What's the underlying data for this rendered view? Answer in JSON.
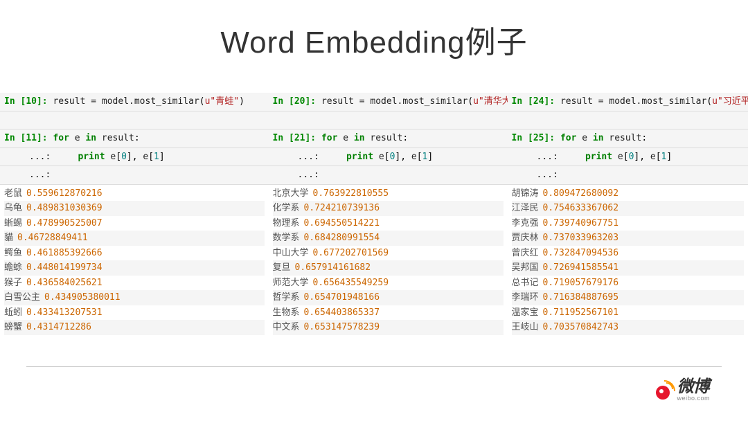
{
  "title": "Word Embedding例子",
  "panels": [
    {
      "in1_num": "10",
      "in2_num": "11",
      "query": "u\"青蛙\"",
      "results": [
        {
          "word": "老鼠",
          "score": "0.559612870216"
        },
        {
          "word": "乌龟",
          "score": "0.489831030369"
        },
        {
          "word": "蜥蜴",
          "score": "0.478990525007"
        },
        {
          "word": "貓",
          "score": "0.46728849411"
        },
        {
          "word": "鳄鱼",
          "score": "0.461885392666"
        },
        {
          "word": "蟾蜍",
          "score": "0.448014199734"
        },
        {
          "word": "猴子",
          "score": "0.436584025621"
        },
        {
          "word": "白雪公主",
          "score": "0.434905380011"
        },
        {
          "word": "蚯蚓",
          "score": "0.433413207531"
        },
        {
          "word": "螃蟹",
          "score": "0.4314712286"
        }
      ]
    },
    {
      "in1_num": "20",
      "in2_num": "21",
      "query": "u\"清华大学",
      "results": [
        {
          "word": "北京大学",
          "score": "0.763922810555"
        },
        {
          "word": "化学系",
          "score": "0.724210739136"
        },
        {
          "word": "物理系",
          "score": "0.694550514221"
        },
        {
          "word": "数学系",
          "score": "0.684280991554"
        },
        {
          "word": "中山大学",
          "score": "0.677202701569"
        },
        {
          "word": "复旦",
          "score": "0.657914161682"
        },
        {
          "word": "师范大学",
          "score": "0.656435549259"
        },
        {
          "word": "哲学系",
          "score": "0.654701948166"
        },
        {
          "word": "生物系",
          "score": "0.654403865337"
        },
        {
          "word": "中文系",
          "score": "0.653147578239"
        }
      ]
    },
    {
      "in1_num": "24",
      "in2_num": "25",
      "query": "u\"习近平\"",
      "results": [
        {
          "word": "胡锦涛",
          "score": "0.809472680092"
        },
        {
          "word": "江泽民",
          "score": "0.754633367062"
        },
        {
          "word": "李克强",
          "score": "0.739740967751"
        },
        {
          "word": "贾庆林",
          "score": "0.737033963203"
        },
        {
          "word": "曾庆红",
          "score": "0.732847094536"
        },
        {
          "word": "吴邦国",
          "score": "0.726941585541"
        },
        {
          "word": "总书记",
          "score": "0.719057679176"
        },
        {
          "word": "李瑞环",
          "score": "0.716384887695"
        },
        {
          "word": "温家宝",
          "score": "0.711952567101"
        },
        {
          "word": "王岐山",
          "score": "0.703570842743"
        }
      ]
    }
  ],
  "code": {
    "assign": "result = model.",
    "method": "most_similar",
    "for_kw": "for",
    "in_kw": "in",
    "var_e": "e",
    "var_result": "result",
    "print_kw": "print",
    "idx0": "0",
    "idx1": "1",
    "dots": "...:"
  },
  "logo": {
    "cn": "微博",
    "en": "weibo.com"
  }
}
